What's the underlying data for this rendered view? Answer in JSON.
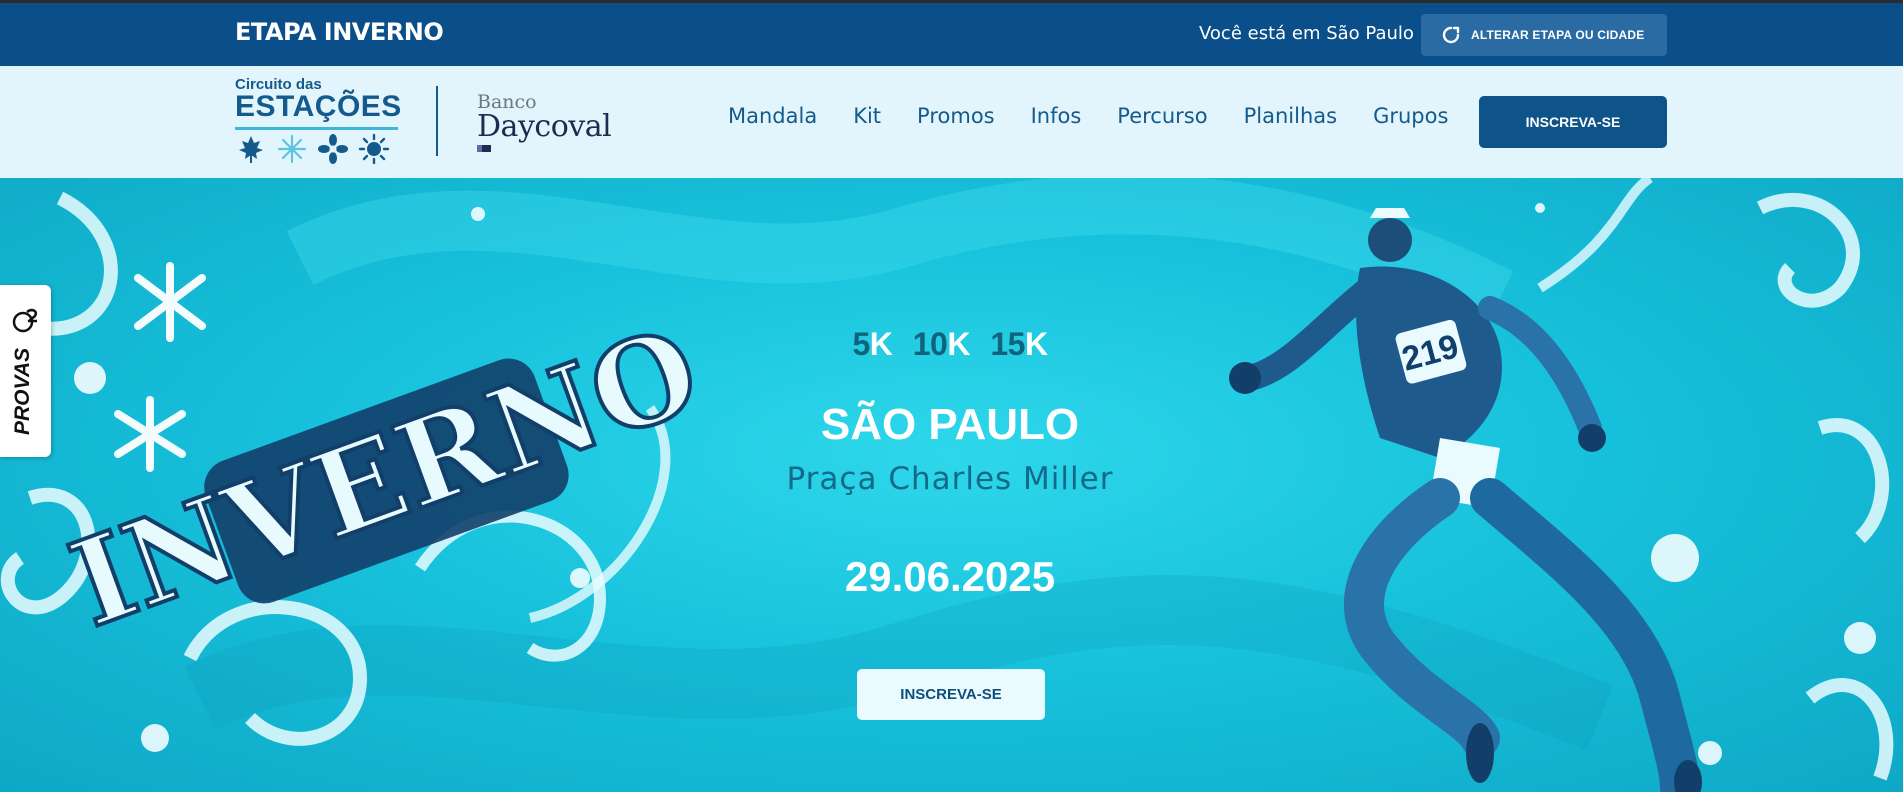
{
  "topbar": {
    "stage_title": "ETAPA INVERNO",
    "location_text": "Você está em São Paulo",
    "change_button_label": "ALTERAR ETAPA OU CIDADE",
    "change_icon": "refresh-icon"
  },
  "logo": {
    "line1": "Circuito das",
    "line2": "ESTAÇÕES",
    "season_icons": [
      "maple-leaf-icon",
      "snowflake-icon",
      "flower-icon",
      "sun-icon"
    ]
  },
  "sponsor": {
    "line1": "Banco",
    "line2": "Daycoval"
  },
  "nav": {
    "items": [
      {
        "label": "Mandala"
      },
      {
        "label": "Kit"
      },
      {
        "label": "Promos"
      },
      {
        "label": "Infos"
      },
      {
        "label": "Percurso"
      },
      {
        "label": "Planilhas"
      },
      {
        "label": "Grupos"
      }
    ],
    "cta_label": "INSCREVA-SE"
  },
  "side_tab": {
    "label": "PROVAS",
    "icon": "o2-logo-icon"
  },
  "hero": {
    "artwork_word": "INVERNO",
    "bib_number": "219",
    "distances": [
      {
        "num": "5",
        "unit": "K"
      },
      {
        "num": "10",
        "unit": "K"
      },
      {
        "num": "15",
        "unit": "K"
      }
    ],
    "city": "SÃO PAULO",
    "venue": "Praça Charles Miller",
    "date": "29.06.2025",
    "cta_label": "INSCREVA-SE"
  },
  "colors": {
    "topbar_bg": "#0b4f8a",
    "nav_bg": "#e2f5fc",
    "hero_bg": "#18c2dc",
    "accent_dark": "#0f5488",
    "venue_text": "#126a8a"
  }
}
